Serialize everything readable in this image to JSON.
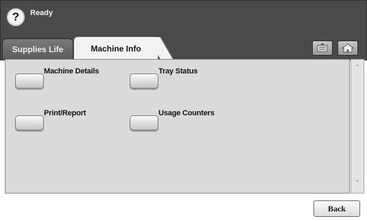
{
  "status": {
    "help_icon_glyph": "?",
    "text": "Ready"
  },
  "tabs": [
    {
      "label": "Supplies Life",
      "active": false
    },
    {
      "label": "Machine Info",
      "active": true
    }
  ],
  "toolbar": {
    "icons": [
      "job-status-icon",
      "home-icon"
    ]
  },
  "menu": {
    "items": [
      {
        "label": "Machine Details"
      },
      {
        "label": "Tray Status"
      },
      {
        "label": "Print/Report"
      },
      {
        "label": "Usage Counters"
      }
    ]
  },
  "scrollbar": {
    "up_glyph": "˄",
    "down_glyph": "˅"
  },
  "footer": {
    "back_label": "Back"
  },
  "colors": {
    "topbar": "#4a4a4a",
    "panel": "#dadada",
    "active_tab": "#f2f2f2"
  }
}
